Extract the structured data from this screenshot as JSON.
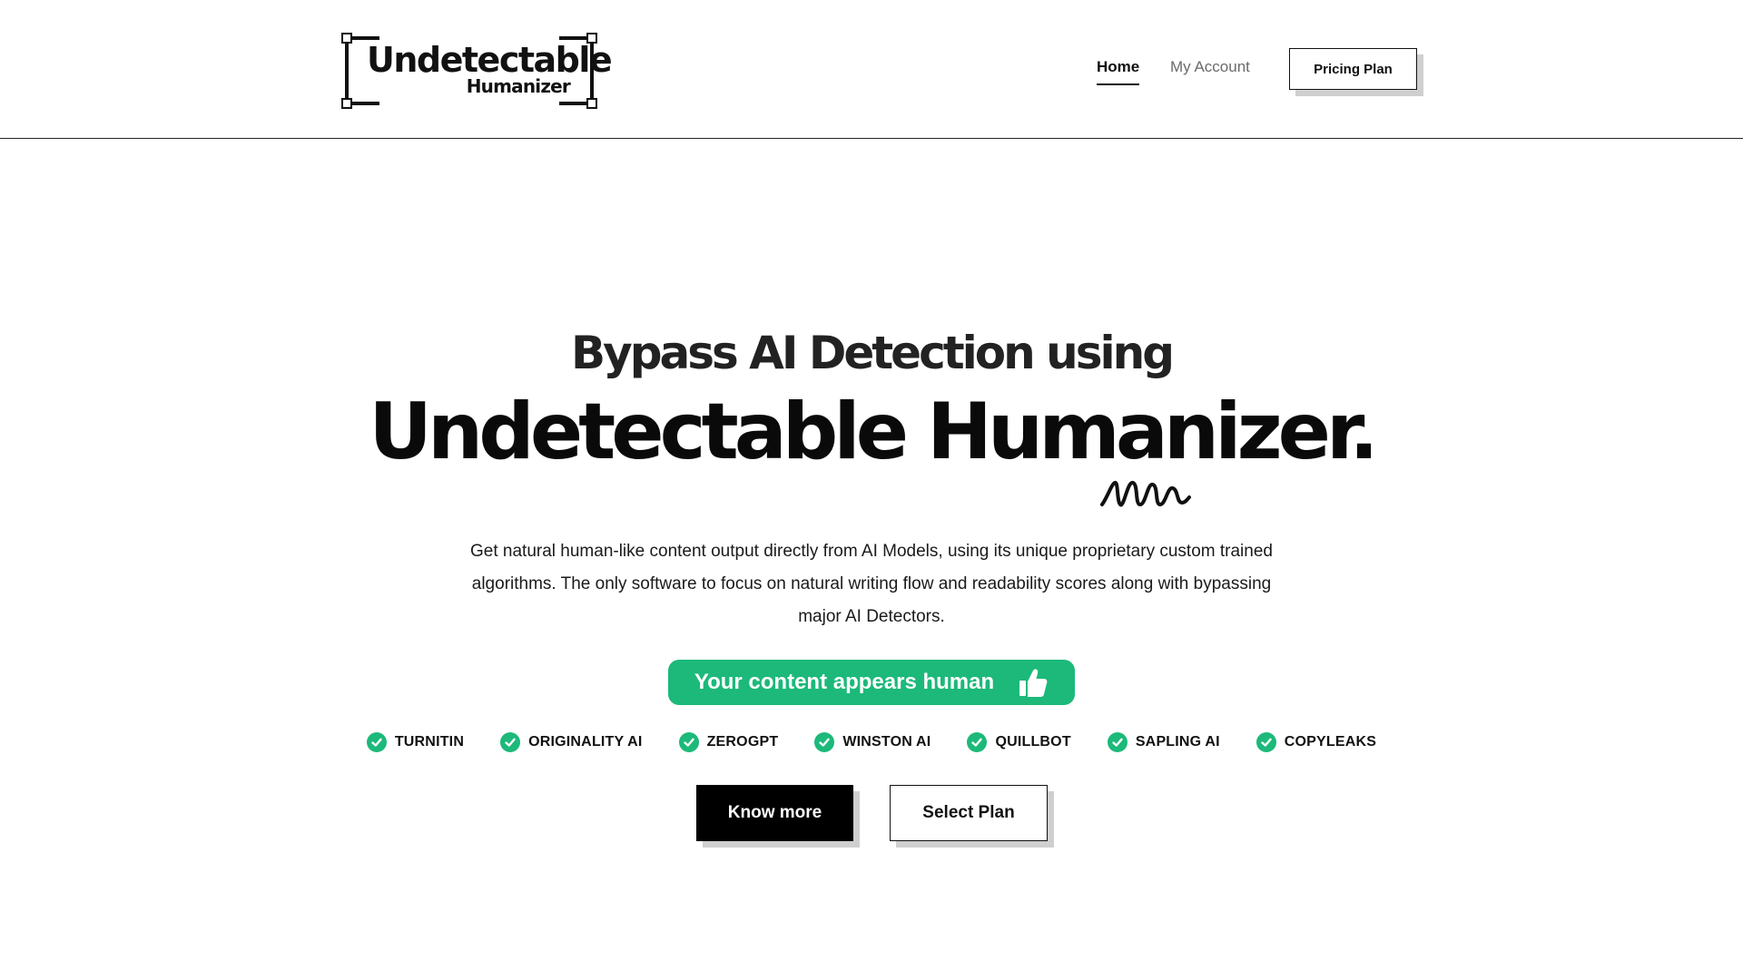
{
  "header": {
    "logo": {
      "title": "Undetectable",
      "subtitle": "Humanizer"
    },
    "nav": {
      "items": [
        {
          "label": "Home",
          "active": true
        },
        {
          "label": "My Account",
          "active": false
        }
      ],
      "cta_label": "Pricing Plan"
    }
  },
  "hero": {
    "line1": "Bypass AI Detection using",
    "line2": "Undetectable Humanizer.",
    "description": "Get natural human-like content output directly from AI Models, using its unique proprietary custom trained algorithms. The only software to focus on natural writing flow and readability scores along with bypassing major AI Detectors.",
    "badge": {
      "text": "Your content appears human",
      "icon": "thumbs-up-icon"
    },
    "detectors": [
      {
        "label": "TURNITIN",
        "icon": "check-circle-icon"
      },
      {
        "label": "ORIGINALITY AI",
        "icon": "check-circle-icon"
      },
      {
        "label": "ZEROGPT",
        "icon": "check-circle-icon"
      },
      {
        "label": "WINSTON AI",
        "icon": "check-circle-icon"
      },
      {
        "label": "QUILLBOT",
        "icon": "check-circle-icon"
      },
      {
        "label": "SAPLING AI",
        "icon": "check-circle-icon"
      },
      {
        "label": "COPYLEAKS",
        "icon": "check-circle-icon"
      }
    ],
    "buttons": {
      "primary": "Know more",
      "secondary": "Select Plan"
    }
  },
  "colors": {
    "accent_green": "#1cb97a",
    "text_dark": "#111111",
    "nav_muted": "#6b6b6b",
    "shadow_gray": "#cfcfcf"
  }
}
